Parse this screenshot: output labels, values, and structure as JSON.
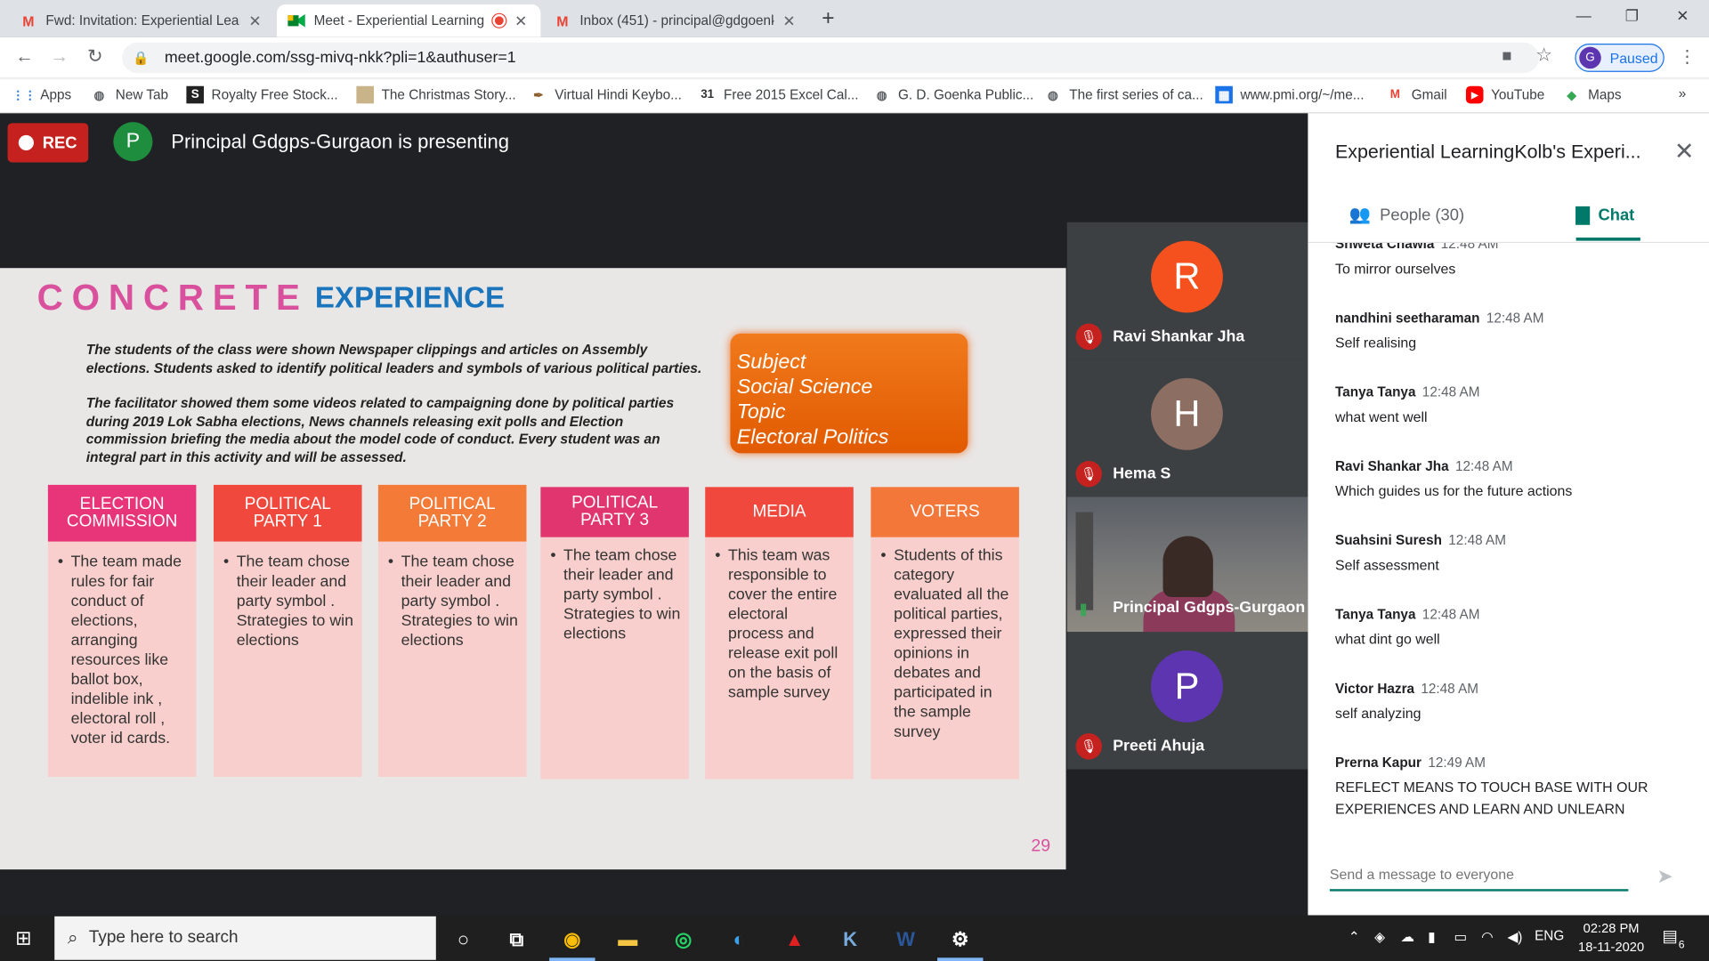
{
  "browser": {
    "tabs": [
      {
        "title": "Fwd: Invitation: Experiential Learn",
        "icon": "gmail-icon"
      },
      {
        "title": "Meet - Experiential Learning",
        "icon": "meet-icon"
      },
      {
        "title": "Inbox (451) - principal@gdgoenk",
        "icon": "gmail-icon"
      }
    ],
    "url": "meet.google.com/ssg-mivq-nkk?pli=1&authuser=1",
    "profile_initial": "G",
    "profile_label": "Paused",
    "bookmarks": [
      {
        "label": "Apps"
      },
      {
        "label": "New Tab"
      },
      {
        "label": "Royalty Free Stock..."
      },
      {
        "label": "The Christmas Story..."
      },
      {
        "label": "Virtual Hindi Keybo..."
      },
      {
        "label": "Free 2015 Excel Cal..."
      },
      {
        "label": "G. D. Goenka Public..."
      },
      {
        "label": "The first series of ca..."
      },
      {
        "label": "www.pmi.org/~/me..."
      },
      {
        "label": "Gmail"
      },
      {
        "label": "YouTube"
      },
      {
        "label": "Maps"
      }
    ],
    "more_bookmarks": "»"
  },
  "meet": {
    "rec_label": "REC",
    "presenter_initial": "P",
    "presenting_text": "Principal Gdgps-Gurgaon is presenting"
  },
  "slide": {
    "title_concrete": "CONCRETE",
    "title_experience": "EXPERIENCE",
    "para1_line1": "The students of the class were shown Newspaper clippings and articles on Assembly",
    "para1_line2": "elections. Students asked to identify political leaders and symbols of various political parties.",
    "para2_line1": "The facilitator showed them some videos related to campaigning done by political parties",
    "para2_line2": "during 2019 Lok Sabha elections, News channels releasing exit polls and Election",
    "para2_line3": "commission briefing the media about the model code of conduct. Every student was an",
    "para2_line4": "integral part in this activity and will be assessed.",
    "subject_lines": [
      "Subject",
      "Social Science",
      "Topic",
      "Electoral Politics"
    ],
    "columns": [
      {
        "head": "ELECTION COMMISSION",
        "color": "#e8357a",
        "body": "The team made rules for fair conduct of elections, arranging resources like ballot box, indelible ink , electoral roll , voter id cards."
      },
      {
        "head": "POLITICAL PARTY 1",
        "color": "#f0483c",
        "body": "The team chose their leader and party symbol . Strategies to win elections"
      },
      {
        "head": "POLITICAL PARTY 2",
        "color": "#f47a37",
        "body": "The team chose their leader and party symbol . Strategies to win elections"
      },
      {
        "head": "POLITICAL PARTY 3",
        "color": "#e0356f",
        "body": "The team chose their leader and party symbol . Strategies to win elections"
      },
      {
        "head": "MEDIA",
        "color": "#f0483c",
        "body": "This team was responsible to cover the entire electoral process and release exit poll on the basis of sample survey"
      },
      {
        "head": "VOTERS",
        "color": "#f4773a",
        "body": "Students of this category evaluated all the political parties, expressed their opinions in debates and participated in the sample survey"
      }
    ],
    "page_number": "29"
  },
  "participants": [
    {
      "initial": "R",
      "name": "Ravi Shankar Jha",
      "color": "#f4511e"
    },
    {
      "initial": "H",
      "name": "Hema S",
      "color": "#8d6e63"
    },
    {
      "name": "Principal Gdgps-Gurgaon"
    },
    {
      "initial": "P",
      "name": "Preeti Ahuja",
      "color": "#5e35b1"
    }
  ],
  "panel": {
    "title": "Experiential LearningKolb's Experi...",
    "people_label": "People (30)",
    "chat_label": "Chat",
    "messages": [
      {
        "sender": "Shweta Chawla",
        "time": "12:48 AM",
        "text": "To mirror ourselves"
      },
      {
        "sender": "nandhini seetharaman",
        "time": "12:48 AM",
        "text": "Self realising"
      },
      {
        "sender": "Tanya Tanya",
        "time": "12:48 AM",
        "text": "what went well"
      },
      {
        "sender": "Ravi Shankar Jha",
        "time": "12:48 AM",
        "text": "Which guides us for the future actions"
      },
      {
        "sender": "Suahsini Suresh",
        "time": "12:48 AM",
        "text": "Self assessment"
      },
      {
        "sender": "Tanya Tanya",
        "time": "12:48 AM",
        "text": "what dint go well"
      },
      {
        "sender": "Victor Hazra",
        "time": "12:48 AM",
        "text": "self analyzing"
      },
      {
        "sender": "Prerna Kapur",
        "time": "12:49 AM",
        "text": "REFLECT MEANS TO TOUCH BASE WITH OUR EXPERIENCES AND LEARN AND UNLEARN"
      }
    ],
    "input_placeholder": "Send a message to everyone"
  },
  "taskbar": {
    "search_placeholder": "Type here to search",
    "language": "ENG",
    "time": "02:28 PM",
    "date": "18-11-2020",
    "notification_count": "6"
  }
}
